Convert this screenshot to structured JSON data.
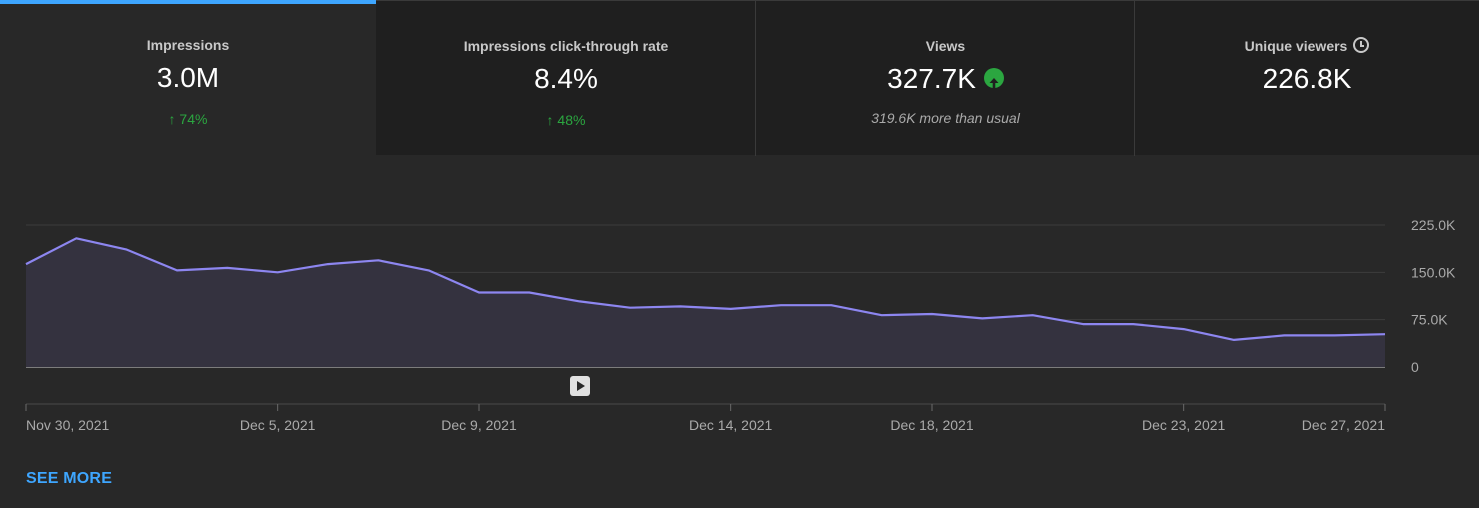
{
  "cards": [
    {
      "label": "Impressions",
      "value": "3.0M",
      "change": "↑ 74%"
    },
    {
      "label": "Impressions click-through rate",
      "value": "8.4%",
      "change": "↑ 48%"
    },
    {
      "label": "Views",
      "value": "327.7K",
      "note": "319.6K more than usual",
      "icon": "up-arrow-circle-icon"
    },
    {
      "label": "Unique viewers",
      "value": "226.8K",
      "icon": "clock-icon"
    }
  ],
  "colors": {
    "accent": "#3ea6ff",
    "positive": "#2ba640",
    "line": "#8d86f0",
    "area": "#34323f",
    "background": "#282828"
  },
  "chart_data": {
    "type": "area",
    "x": [
      "Nov 30, 2021",
      "Dec 1, 2021",
      "Dec 2, 2021",
      "Dec 3, 2021",
      "Dec 4, 2021",
      "Dec 5, 2021",
      "Dec 6, 2021",
      "Dec 7, 2021",
      "Dec 8, 2021",
      "Dec 9, 2021",
      "Dec 10, 2021",
      "Dec 11, 2021",
      "Dec 12, 2021",
      "Dec 13, 2021",
      "Dec 14, 2021",
      "Dec 15, 2021",
      "Dec 16, 2021",
      "Dec 17, 2021",
      "Dec 18, 2021",
      "Dec 19, 2021",
      "Dec 20, 2021",
      "Dec 21, 2021",
      "Dec 22, 2021",
      "Dec 23, 2021",
      "Dec 24, 2021",
      "Dec 25, 2021",
      "Dec 26, 2021",
      "Dec 27, 2021"
    ],
    "values": [
      163000,
      204000,
      186000,
      153000,
      157000,
      150000,
      163000,
      169000,
      153000,
      118000,
      118000,
      104000,
      94000,
      96000,
      92000,
      98000,
      98000,
      82000,
      84000,
      77000,
      82000,
      68000,
      68000,
      60000,
      43000,
      50000,
      50000,
      52000
    ],
    "yticks": [
      "0",
      "75.0K",
      "150.0K",
      "225.0K"
    ],
    "ytick_values": [
      0,
      75000,
      150000,
      225000
    ],
    "xticks": [
      "Nov 30, 2021",
      "Dec 5, 2021",
      "Dec 9, 2021",
      "Dec 14, 2021",
      "Dec 18, 2021",
      "Dec 23, 2021",
      "Dec 27, 2021"
    ],
    "ylim": [
      0,
      225000
    ],
    "grid": true
  },
  "see_more": "SEE MORE"
}
